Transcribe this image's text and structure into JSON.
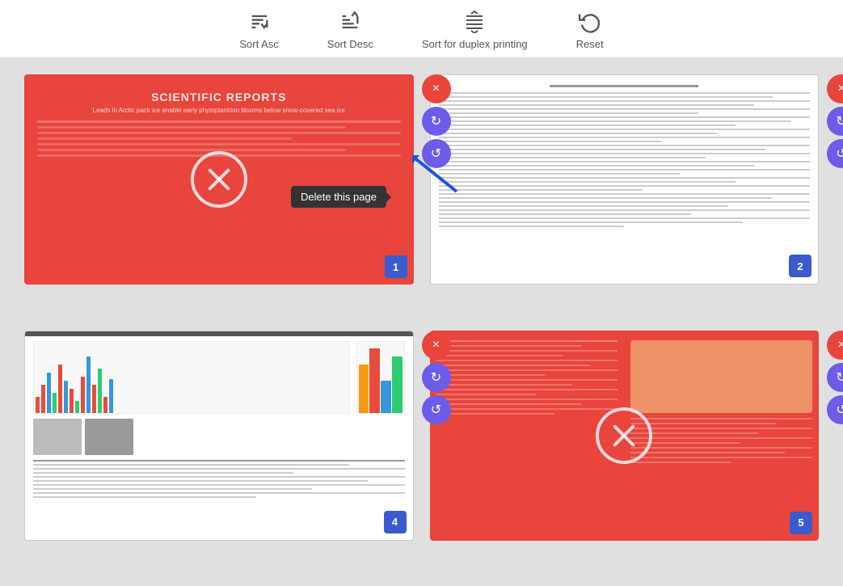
{
  "toolbar": {
    "sort_asc_label": "Sort Asc",
    "sort_desc_label": "Sort Desc",
    "sort_duplex_label": "Sort for duplex printing",
    "reset_label": "Reset"
  },
  "pages": [
    {
      "id": 1,
      "number": "1",
      "type": "red",
      "title": "SCIENTIFIC REPORTS",
      "subtitle": "Leads in Arctic pack ice enable early phytoplankton blooms below snow-covered sea ice"
    },
    {
      "id": 2,
      "number": "2",
      "type": "white"
    },
    {
      "id": 4,
      "number": "4",
      "type": "document"
    },
    {
      "id": 5,
      "number": "5",
      "type": "red-image"
    }
  ],
  "tooltip": {
    "delete_label": "Delete this page"
  },
  "actions": {
    "delete_label": "×",
    "rotate_cw_label": "↻",
    "rotate_ccw_label": "↺"
  }
}
